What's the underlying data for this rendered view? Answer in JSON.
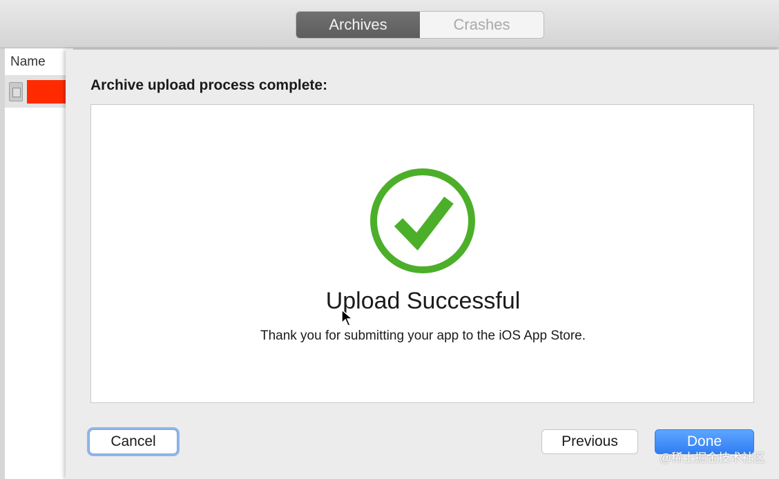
{
  "toolbar": {
    "tabs": [
      {
        "label": "Archives",
        "active": true
      },
      {
        "label": "Crashes",
        "active": false
      }
    ]
  },
  "sidebar": {
    "column_header": "Name"
  },
  "sheet": {
    "title": "Archive upload process complete:",
    "status_icon": "checkmark-circle-icon",
    "success_title": "Upload Successful",
    "success_message": "Thank you for submitting your app to the iOS App Store.",
    "buttons": {
      "cancel": "Cancel",
      "previous": "Previous",
      "done": "Done"
    }
  },
  "watermark": "@稀土掘金技术社区",
  "colors": {
    "success_green": "#4caf2a",
    "done_blue": "#2f7df3",
    "redaction_red": "#ff2a00"
  }
}
